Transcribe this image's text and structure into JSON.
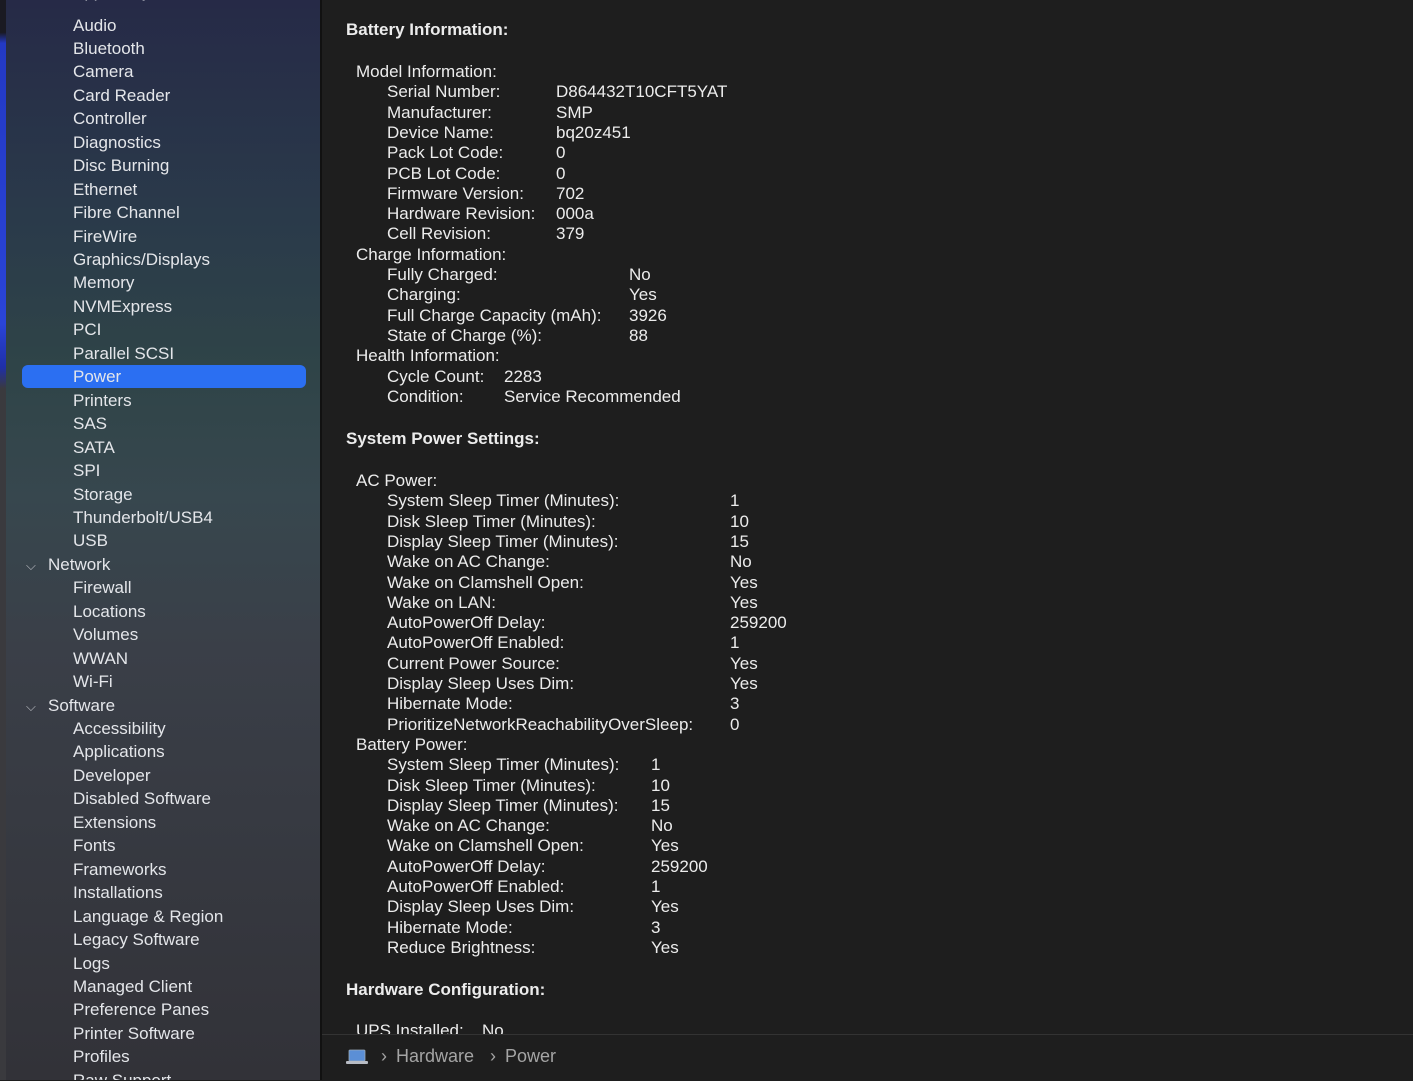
{
  "sidebar": {
    "cut_top_label": "Apple Pay",
    "items_top": [
      "Audio",
      "Bluetooth",
      "Camera",
      "Card Reader",
      "Controller",
      "Diagnostics",
      "Disc Burning",
      "Ethernet",
      "Fibre Channel",
      "FireWire",
      "Graphics/Displays",
      "Memory",
      "NVMExpress",
      "PCI",
      "Parallel SCSI",
      "Power",
      "Printers",
      "SAS",
      "SATA",
      "SPI",
      "Storage",
      "Thunderbolt/USB4",
      "USB"
    ],
    "selected": "Power",
    "network_label": "Network",
    "network_items": [
      "Firewall",
      "Locations",
      "Volumes",
      "WWAN",
      "Wi-Fi"
    ],
    "software_label": "Software",
    "software_items": [
      "Accessibility",
      "Applications",
      "Developer",
      "Disabled Software",
      "Extensions",
      "Fonts",
      "Frameworks",
      "Installations",
      "Language & Region",
      "Legacy Software",
      "Logs",
      "Managed Client",
      "Preference Panes",
      "Printer Software",
      "Profiles",
      "Raw Support"
    ]
  },
  "battery": {
    "title": "Battery Information:",
    "model_heading": "Model Information:",
    "model": [
      [
        "Serial Number:",
        "D864432T10CFT5YAT"
      ],
      [
        "Manufacturer:",
        "SMP"
      ],
      [
        "Device Name:",
        "bq20z451"
      ],
      [
        "Pack Lot Code:",
        "0"
      ],
      [
        "PCB Lot Code:",
        "0"
      ],
      [
        "Firmware Version:",
        "702"
      ],
      [
        "Hardware Revision:",
        "000a"
      ],
      [
        "Cell Revision:",
        "379"
      ]
    ],
    "charge_heading": "Charge Information:",
    "charge": [
      [
        "Fully Charged:",
        "No"
      ],
      [
        "Charging:",
        "Yes"
      ],
      [
        "Full Charge Capacity (mAh):",
        "3926"
      ],
      [
        "State of Charge (%):",
        "88"
      ]
    ],
    "health_heading": "Health Information:",
    "health": [
      [
        "Cycle Count:",
        "2283"
      ],
      [
        "Condition:",
        "Service Recommended"
      ]
    ]
  },
  "power_settings": {
    "title": "System Power Settings:",
    "ac_heading": "AC Power:",
    "ac": [
      [
        "System Sleep Timer (Minutes):",
        "1"
      ],
      [
        "Disk Sleep Timer (Minutes):",
        "10"
      ],
      [
        "Display Sleep Timer (Minutes):",
        "15"
      ],
      [
        "Wake on AC Change:",
        "No"
      ],
      [
        "Wake on Clamshell Open:",
        "Yes"
      ],
      [
        "Wake on LAN:",
        "Yes"
      ],
      [
        "AutoPowerOff Delay:",
        "259200"
      ],
      [
        "AutoPowerOff Enabled:",
        "1"
      ],
      [
        "Current Power Source:",
        "Yes"
      ],
      [
        "Display Sleep Uses Dim:",
        "Yes"
      ],
      [
        "Hibernate Mode:",
        "3"
      ],
      [
        "PrioritizeNetworkReachabilityOverSleep:",
        "0"
      ]
    ],
    "battery_heading": "Battery Power:",
    "battery": [
      [
        "System Sleep Timer (Minutes):",
        "1"
      ],
      [
        "Disk Sleep Timer (Minutes):",
        "10"
      ],
      [
        "Display Sleep Timer (Minutes):",
        "15"
      ],
      [
        "Wake on AC Change:",
        "No"
      ],
      [
        "Wake on Clamshell Open:",
        "Yes"
      ],
      [
        "AutoPowerOff Delay:",
        "259200"
      ],
      [
        "AutoPowerOff Enabled:",
        "1"
      ],
      [
        "Display Sleep Uses Dim:",
        "Yes"
      ],
      [
        "Hibernate Mode:",
        "3"
      ],
      [
        "Reduce Brightness:",
        "Yes"
      ]
    ]
  },
  "hardware_config": {
    "title": "Hardware Configuration:",
    "rows": [
      [
        "UPS Installed:",
        "No"
      ]
    ]
  },
  "statusbar": {
    "icon": "computer-icon",
    "separator": "›",
    "crumbs": [
      "Hardware",
      "Power"
    ]
  }
}
